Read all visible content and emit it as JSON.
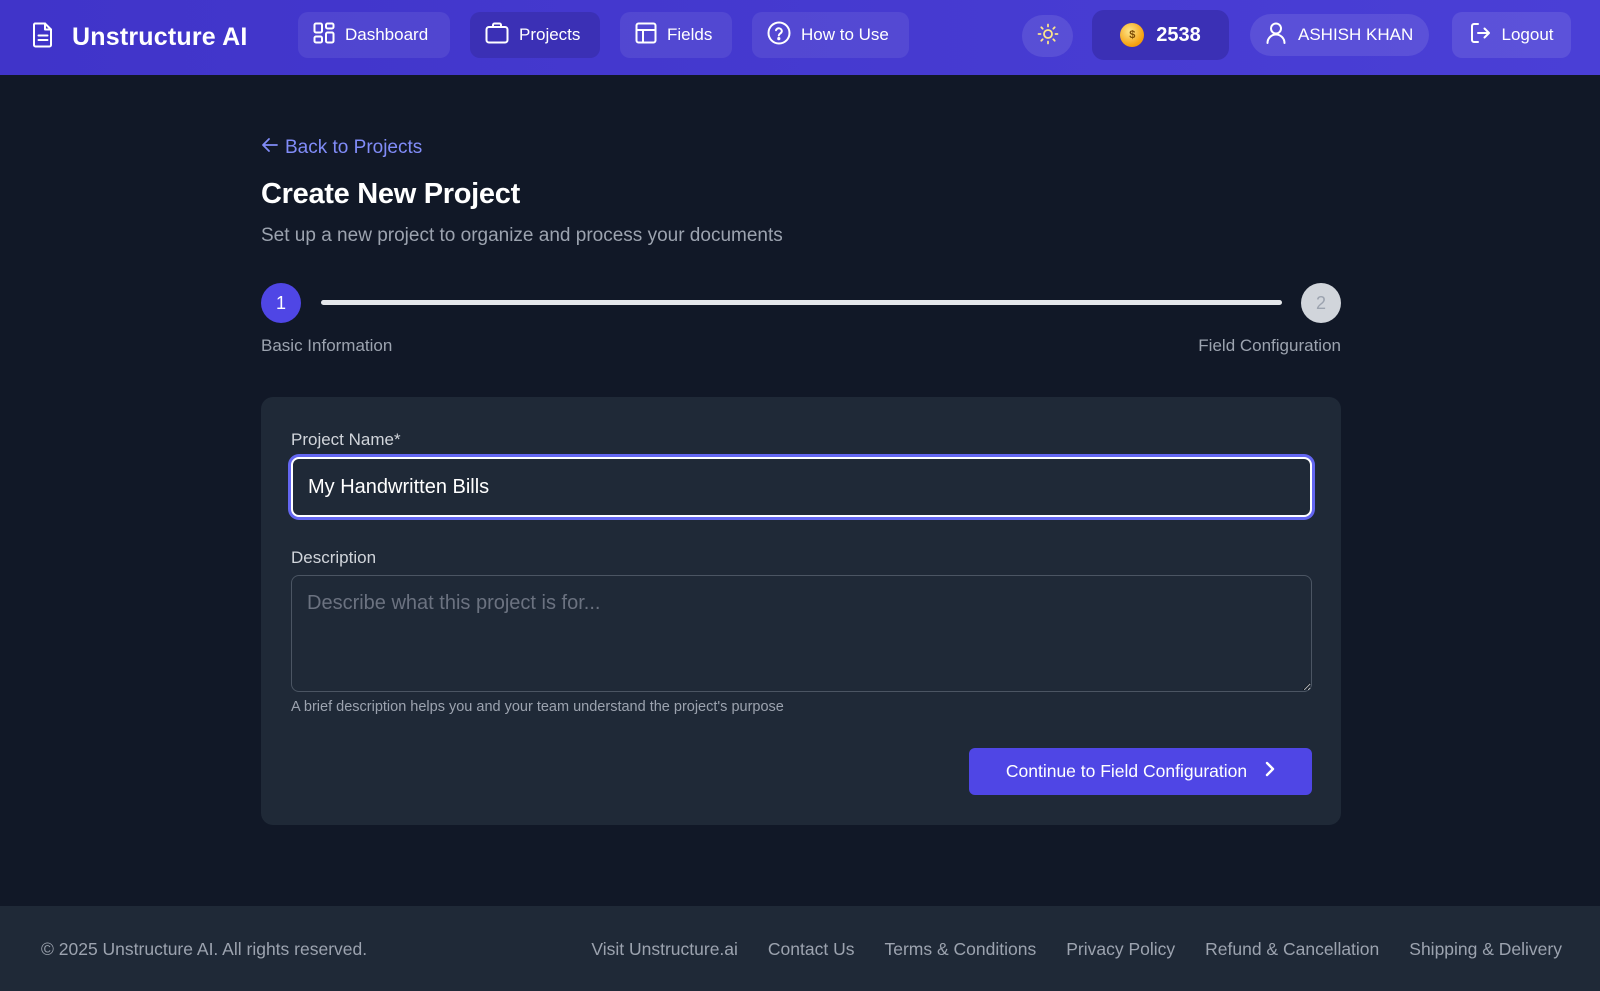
{
  "header": {
    "brand": "Unstructure AI",
    "nav": [
      {
        "label": "Dashboard",
        "icon": "dashboard-icon"
      },
      {
        "label": "Projects",
        "icon": "briefcase-icon",
        "active": true
      },
      {
        "label": "Fields",
        "icon": "table-icon"
      },
      {
        "label": "How to Use",
        "icon": "help-circle-icon"
      }
    ],
    "credits": "2538",
    "user_name": "ASHISH KHAN",
    "logout_label": "Logout"
  },
  "main": {
    "back_link": "Back to Projects",
    "title": "Create New Project",
    "subtitle": "Set up a new project to organize and process your documents",
    "steps": [
      {
        "number": "1",
        "label": "Basic Information",
        "active": true
      },
      {
        "number": "2",
        "label": "Field Configuration",
        "active": false
      }
    ],
    "form": {
      "name_label": "Project Name*",
      "name_value": "My Handwritten Bills",
      "description_label": "Description",
      "description_placeholder": "Describe what this project is for...",
      "description_help": "A brief description helps you and your team understand the project's purpose",
      "continue_label": "Continue to Field Configuration"
    }
  },
  "footer": {
    "copyright": "© 2025 Unstructure AI. All rights reserved.",
    "links": [
      "Visit Unstructure.ai",
      "Contact Us",
      "Terms & Conditions",
      "Privacy Policy",
      "Refund & Cancellation",
      "Shipping & Delivery"
    ]
  },
  "colors": {
    "header_bg": "#4338ca",
    "page_bg": "#111827",
    "card_bg": "#1f2937",
    "accent": "#4f46e5",
    "link": "#818cf8"
  }
}
